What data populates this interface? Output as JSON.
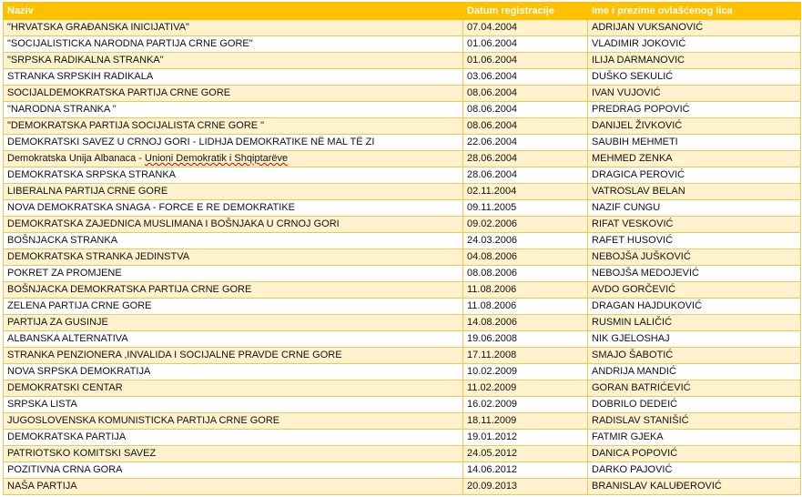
{
  "header": {
    "name": "Naziv",
    "date": "Datum registracije",
    "person": "Ime i prezime ovlašćenog lica"
  },
  "rows": [
    {
      "name": "\"HRVATSKA GRAĐANSKA INICIJATIVA\"",
      "date": "07.04.2004",
      "person": "ADRIJAN VUKSANOVIĆ"
    },
    {
      "name": "\"SOCIJALISTICKA NARODNA PARTIJA CRNE GORE\"",
      "date": "01.06.2004",
      "person": "VLADIMIR JOKOVIĆ"
    },
    {
      "name": "\"SRPSKA RADIKALNA STRANKA\"",
      "date": "01.06.2004",
      "person": "ILIJA DARMANOVIC"
    },
    {
      "name": "STRANKA SRPSKIH RADIKALA",
      "date": "03.06.2004",
      "person": "DUŠKO SEKULIĆ"
    },
    {
      "name": "SOCIJALDEMOKRATSKA PARTIJA CRNE GORE",
      "date": "08.06.2004",
      "person": "IVAN VUJOVIĆ"
    },
    {
      "name": "\"NARODNA STRANKA \"",
      "date": "08.06.2004",
      "person": "PREDRAG POPOVIĆ"
    },
    {
      "name": "\"DEMOKRATSKA PARTIJA SOCIJALISTA CRNE GORE \"",
      "date": "08.06.2004",
      "person": "DANIJEL ŽIVKOVIĆ"
    },
    {
      "name": "DEMOKRATSKI SAVEZ U CRNOJ GORI  - LIDHJA DEMOKRATIKE NË MAL TË ZI",
      "date": "22.06.2004",
      "person": "SAUBIH MEHMETI"
    },
    {
      "name": "Demokratska Unija Albanaca - ",
      "name_wavy": "Unioni Demokratik i Shqiptarëve",
      "date": "28.06.2004",
      "person": "MEHMED ZENKA"
    },
    {
      "name": "DEMOKRATSKA SRPSKA STRANKA",
      "date": "28.06.2004",
      "person": "DRAGICA PEROVIĆ"
    },
    {
      "name": "LIBERALNA PARTIJA CRNE GORE",
      "date": "02.11.2004",
      "person": "VATROSLAV BELAN"
    },
    {
      "name": "NOVA DEMOKRATSKA SNAGA  - FORCE E RE DEMOKRATIKE",
      "date": "09.11.2005",
      "person": "NAZIF CUNGU"
    },
    {
      "name": "DEMOKRATSKA ZAJEDNICA MUSLIMANA I BOŠNJAKA U CRNOJ GORI",
      "date": "09.02.2006",
      "person": "RIFAT VESKOVIĆ"
    },
    {
      "name": "BOŠNJACKA STRANKA",
      "date": "24.03.2006",
      "person": "RAFET HUSOVIĆ"
    },
    {
      "name": "DEMOKRATSKA STRANKA JEDINSTVA",
      "date": "04.08.2006",
      "person": "NEBOJŠA JUŠKOVIĆ"
    },
    {
      "name": "POKRET ZA PROMJENE",
      "date": "08.08.2006",
      "person": "NEBOJŠA MEDOJEVIĆ"
    },
    {
      "name": "BOŠNJACKA DEMOKRATSKA PARTIJA CRNE GORE",
      "date": "11.08.2006",
      "person": "AVDO GORČEVIĆ"
    },
    {
      "name": "ZELENA PARTIJA CRNE GORE",
      "date": "11.08.2006",
      "person": "DRAGAN HAJDUKOVIĆ"
    },
    {
      "name": "PARTIJA ZA GUSINJE",
      "date": "14.08.2006",
      "person": "RUSMIN LALIČIĆ"
    },
    {
      "name": "ALBANSKA  ALTERNATIVA",
      "date": "19.06.2008",
      "person": "NIK GJELOSHAJ"
    },
    {
      "name": "STRANKA PENZIONERA ,INVALIDA I SOCIJALNE PRAVDE CRNE GORE",
      "date": "17.11.2008",
      "person": "SMAJO ŠABOTIĆ"
    },
    {
      "name": "NOVA SRPSKA DEMOKRATIJA",
      "date": "10.02.2009",
      "person": "ANDRIJA MANDIĆ"
    },
    {
      "name": "DEMOKRATSKI  CENTAR",
      "date": "11.02.2009",
      "person": "GORAN BATRIĆEVIĆ"
    },
    {
      "name": "SRPSKA  LISTA",
      "date": "16.02.2009",
      "person": "DOBRILO DEDEIĆ"
    },
    {
      "name": "JUGOSLOVENSKA KOMUNISTICKA PARTIJA CRNE GORE",
      "date": "18.11.2009",
      "person": "RADISLAV STANIŠIĆ"
    },
    {
      "name": "DEMOKRATSKA PARTIJA",
      "date": "19.01.2012",
      "person": "FATMIR GJEKA"
    },
    {
      "name": "PATRIOTSKO KOMITSKI SAVEZ",
      "date": "24.05.2012",
      "person": "DANICA POPOVIĆ"
    },
    {
      "name": "POZITIVNA CRNA GORA",
      "date": "14.06.2012",
      "person": "DARKO PAJOVIĆ"
    },
    {
      "name": "NAŠA PARTIJA",
      "date": "20.09.2013",
      "person": "BRANISLAV KALUĐEROVIĆ"
    }
  ]
}
